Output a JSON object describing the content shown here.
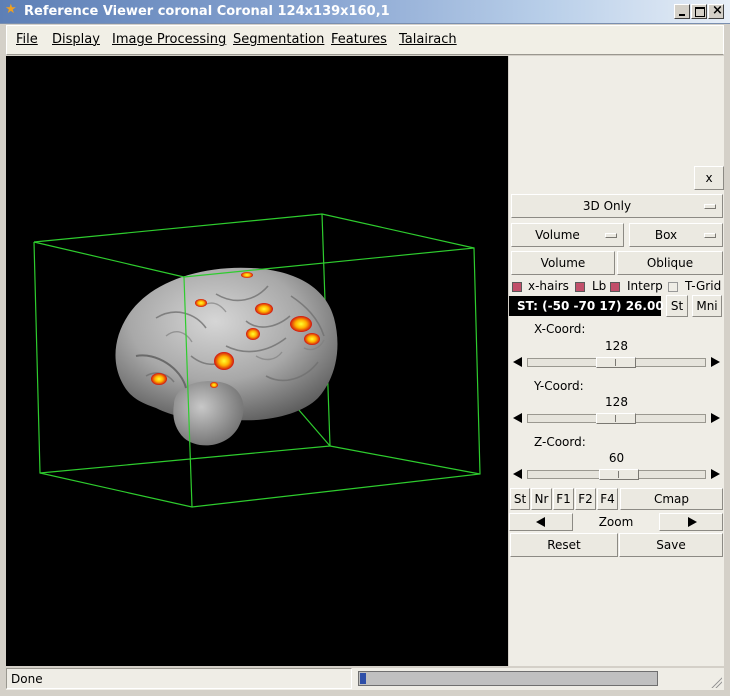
{
  "window": {
    "title": "Reference Viewer coronal Coronal 124x139x160,1",
    "icon": "star-icon"
  },
  "menubar": {
    "items": [
      "File",
      "Display",
      "Image Processing",
      "Segmentation",
      "Features",
      "Talairach"
    ]
  },
  "viewport": {
    "background": "#000000",
    "box_color": "#2ecc2e"
  },
  "panel": {
    "close_label": "x",
    "view_mode": "3D Only",
    "render_mode": "Volume",
    "overlay_mode": "Box",
    "volume_button": "Volume",
    "oblique_button": "Oblique",
    "checks": [
      {
        "label": "x-hairs",
        "checked": true
      },
      {
        "label": "Lb",
        "checked": true
      },
      {
        "label": "Interp",
        "checked": true
      },
      {
        "label": "T-Grid",
        "checked": false
      }
    ],
    "coord_readout": "ST: (-50 -70 17) 26.00",
    "st_button": "St",
    "mni_button": "Mni",
    "x_label": "X-Coord:",
    "x_value": "128",
    "y_label": "Y-Coord:",
    "y_value": "128",
    "z_label": "Z-Coord:",
    "z_value": "60",
    "bottom_buttons": [
      "St",
      "Nr",
      "F1",
      "F2",
      "F4"
    ],
    "cmap_button": "Cmap",
    "zoom_label": "Zoom",
    "reset_button": "Reset",
    "save_button": "Save"
  },
  "status": {
    "text": "Done",
    "progress": 0.02
  }
}
